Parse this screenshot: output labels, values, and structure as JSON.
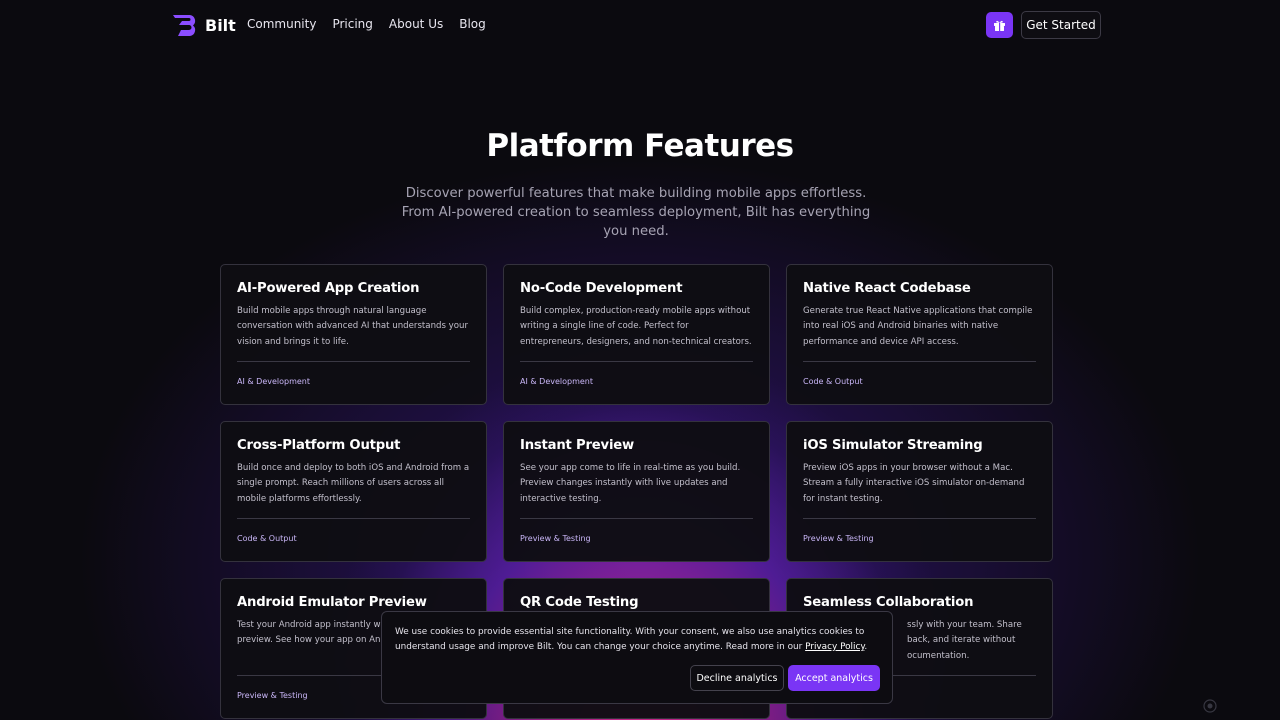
{
  "header": {
    "brand": "Bilt",
    "nav": [
      "Community",
      "Pricing",
      "About Us",
      "Blog"
    ],
    "gift_icon": "gift-icon",
    "cta_label": "Get Started"
  },
  "hero": {
    "title": "Platform Features",
    "subtitle": "Discover powerful features that make building mobile apps effortless. From AI-powered creation to seamless deployment, Bilt has everything you need."
  },
  "features": [
    {
      "title": "AI-Powered App Creation",
      "description": "Build mobile apps through natural language conversation with advanced AI that understands your vision and brings it to life.",
      "tag": "AI & Development"
    },
    {
      "title": "No-Code Development",
      "description": "Build complex, production-ready mobile apps without writing a single line of code. Perfect for entrepreneurs, designers, and non-technical creators.",
      "tag": "AI & Development"
    },
    {
      "title": "Native React Codebase",
      "description": "Generate true React Native applications that compile into real iOS and Android binaries with native performance and device API access.",
      "tag": "Code & Output"
    },
    {
      "title": "Cross-Platform Output",
      "description": "Build once and deploy to both iOS and Android from a single prompt. Reach millions of users across all mobile platforms effortlessly.",
      "tag": "Code & Output"
    },
    {
      "title": "Instant Preview",
      "description": "See your app come to life in real-time as you build. Preview changes instantly with live updates and interactive testing.",
      "tag": "Preview & Testing"
    },
    {
      "title": "iOS Simulator Streaming",
      "description": "Preview iOS apps in your browser without a Mac. Stream a fully interactive iOS simulator on-demand for instant testing.",
      "tag": "Preview & Testing"
    },
    {
      "title": "Android Emulator Preview",
      "description": "Test your Android app instantly with emulator preview. See how your app on Android devices.",
      "tag": "Preview & Testing"
    },
    {
      "title": "QR Code Testing",
      "description": "",
      "tag": ""
    },
    {
      "title": "Seamless Collaboration",
      "description": "ssly with your team. Share back, and iterate without ocumentation.",
      "tag": ""
    }
  ],
  "cookie_banner": {
    "text": "We use cookies to provide essential site functionality. With your consent, we also use analytics cookies to understand usage and improve Bilt. You can change your choice anytime. Read more in our ",
    "link": "Privacy Policy",
    "text_end": ".",
    "decline_label": "Decline analytics",
    "accept_label": "Accept analytics"
  },
  "colors": {
    "accent": "#7a35f5",
    "background": "#0b0a0f",
    "glow_pink": "#e22a8c",
    "glow_purple": "#6928dc",
    "tag_color": "#c9b6f7"
  }
}
